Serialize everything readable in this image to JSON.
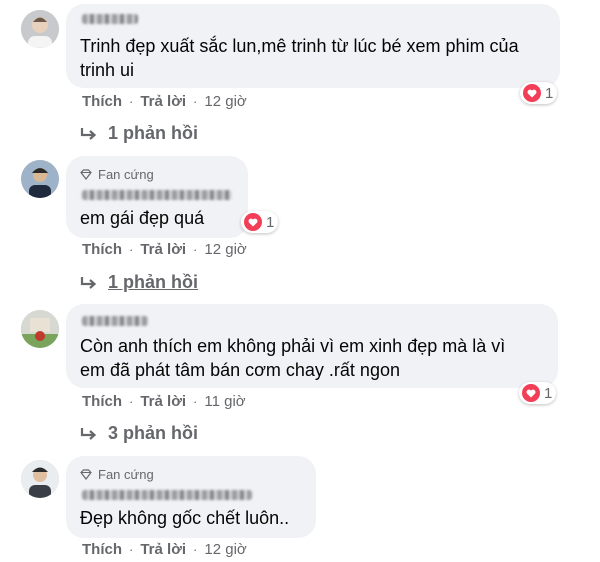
{
  "comments": [
    {
      "badge": "",
      "text_lines": [
        "Trinh đẹp xuất sắc lun,mê trinh từ lúc bé xem phim của",
        "trinh ui"
      ],
      "reaction_count": "1",
      "like": "Thích",
      "reply": "Trả lời",
      "time": "12 giờ",
      "replies": "1 phản hồi"
    },
    {
      "badge": "Fan cứng",
      "text_lines": [
        "em gái đẹp quá"
      ],
      "reaction_count": "1",
      "like": "Thích",
      "reply": "Trả lời",
      "time": "12 giờ",
      "replies": "1 phản hồi"
    },
    {
      "badge": "",
      "text_lines": [
        "Còn anh thích em không phải vì em xinh đẹp mà là vì",
        "em đã phát tâm bán cơm chay .rất ngon"
      ],
      "reaction_count": "1",
      "like": "Thích",
      "reply": "Trả lời",
      "time": "11 giờ",
      "replies": "3 phản hồi"
    },
    {
      "badge": "Fan cứng",
      "text_lines": [
        "Đẹp không gốc chết luôn.."
      ],
      "like": "Thích",
      "reply": "Trả lời",
      "time": "12 giờ"
    }
  ],
  "colors": {
    "bubble": "#f0f2f5",
    "meta": "#65676b",
    "heart": "#f33e58"
  },
  "icons": [
    "avatar",
    "diamond-icon",
    "heart-reaction-icon",
    "reply-arrow-icon"
  ]
}
